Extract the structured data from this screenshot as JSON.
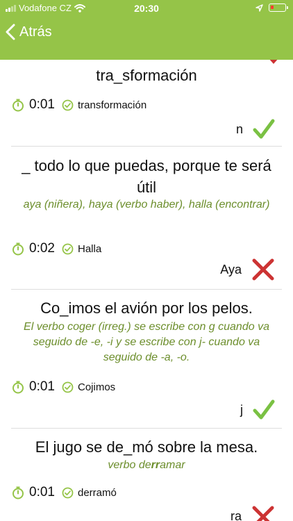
{
  "status": {
    "carrier": "Vodafone CZ",
    "time": "20:30"
  },
  "nav": {
    "back_label": "Atrás"
  },
  "items": [
    {
      "question": "tra_sformación",
      "hint": "",
      "time": "0:01",
      "answer": "transformación",
      "result_letter": "n",
      "correct": true
    },
    {
      "question": "_ todo lo que puedas, porque te será útil",
      "hint": "aya (niñera), haya (verbo haber), halla (encontrar)",
      "time": "0:02",
      "answer": "Halla",
      "result_letter": "Aya",
      "correct": false
    },
    {
      "question": "Co_imos el avión por los pelos.",
      "hint": "El verbo coger (irreg.) se escribe con g cuando va seguido de -e, -i y se escribe con j- cuando va seguido de -a, -o.",
      "time": "0:01",
      "answer": "Cojimos",
      "result_letter": "j",
      "correct": true
    },
    {
      "question": "El jugo se de_mó sobre la mesa.",
      "hint": "verbo derramar",
      "time": "0:01",
      "answer": "derramó",
      "result_letter": "ra",
      "correct": false
    }
  ],
  "colors": {
    "accent": "#95c448",
    "check": "#7ac143",
    "cross": "#cc3333",
    "hint": "#6c8e2c"
  }
}
